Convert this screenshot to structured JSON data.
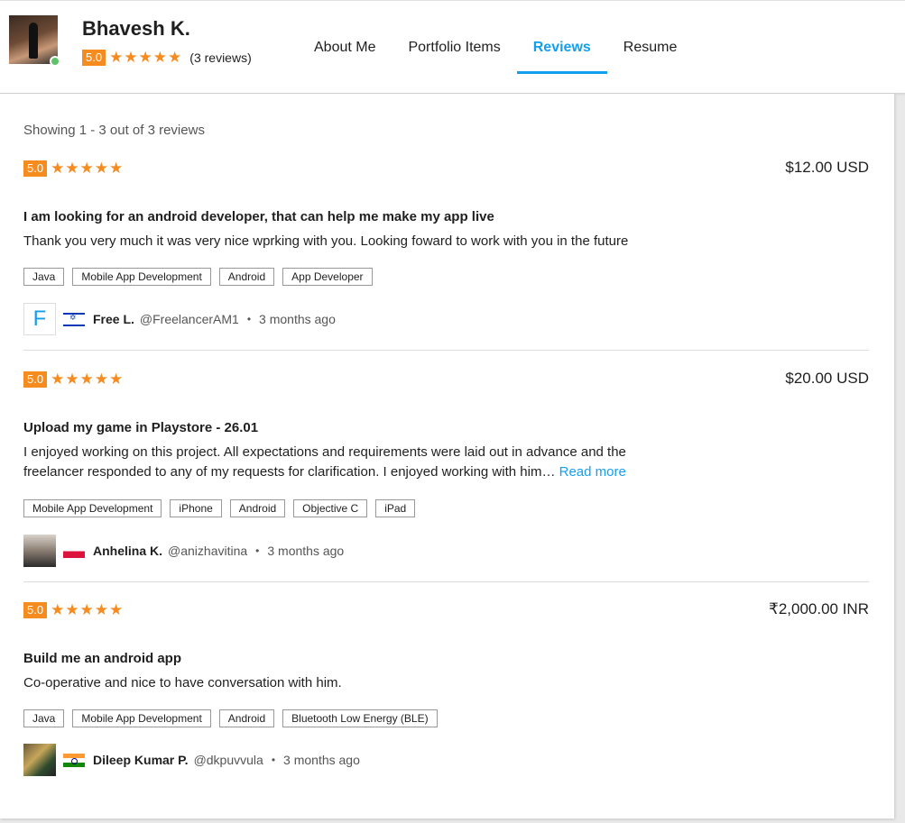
{
  "profile": {
    "name": "Bhavesh K.",
    "rating": "5.0",
    "stars": "★★★★★",
    "review_count": "(3 reviews)"
  },
  "tabs": [
    {
      "label": "About Me",
      "active": false
    },
    {
      "label": "Portfolio Items",
      "active": false
    },
    {
      "label": "Reviews",
      "active": true
    },
    {
      "label": "Resume",
      "active": false
    }
  ],
  "showing": "Showing 1 - 3 out of 3 reviews",
  "reviews": [
    {
      "rating": "5.0",
      "stars": "★★★★★",
      "price": "$12.00 USD",
      "title": "I am looking for an android developer, that can help me make my app live",
      "body": "Thank you very much it was very nice wprking with you. Looking foward to work with you in the future",
      "read_more": "",
      "tags": [
        "Java",
        "Mobile App Development",
        "Android",
        "App Developer"
      ],
      "reviewer": {
        "avatar_letter": "F",
        "name": "Free L.",
        "handle": "@FreelancerAM1",
        "time": "3 months ago",
        "flag": "israel-flag"
      }
    },
    {
      "rating": "5.0",
      "stars": "★★★★★",
      "price": "$20.00 USD",
      "title": "Upload my game in Playstore - 26.01",
      "body": "I enjoyed working on this project. All expectations and requirements were laid out in advance and the freelancer responded to any of my requests for clarification. I enjoyed working with him…",
      "read_more": "Read more",
      "tags": [
        "Mobile App Development",
        "iPhone",
        "Android",
        "Objective C",
        "iPad"
      ],
      "reviewer": {
        "avatar_letter": "",
        "name": "Anhelina K.",
        "handle": "@anizhavitina",
        "time": "3 months ago",
        "flag": "poland-flag"
      }
    },
    {
      "rating": "5.0",
      "stars": "★★★★★",
      "price": "₹2,000.00 INR",
      "title": "Build me an android app",
      "body": "Co-operative and nice to have conversation with him.",
      "read_more": "",
      "tags": [
        "Java",
        "Mobile App Development",
        "Android",
        "Bluetooth Low Energy (BLE)"
      ],
      "reviewer": {
        "avatar_letter": "",
        "name": "Dileep Kumar P.",
        "handle": "@dkpuvvula",
        "time": "3 months ago",
        "flag": "india-flag"
      }
    }
  ],
  "colors": {
    "accent": "#139ff0",
    "rating_orange": "#f68b1f",
    "online_green": "#5dc26a"
  }
}
